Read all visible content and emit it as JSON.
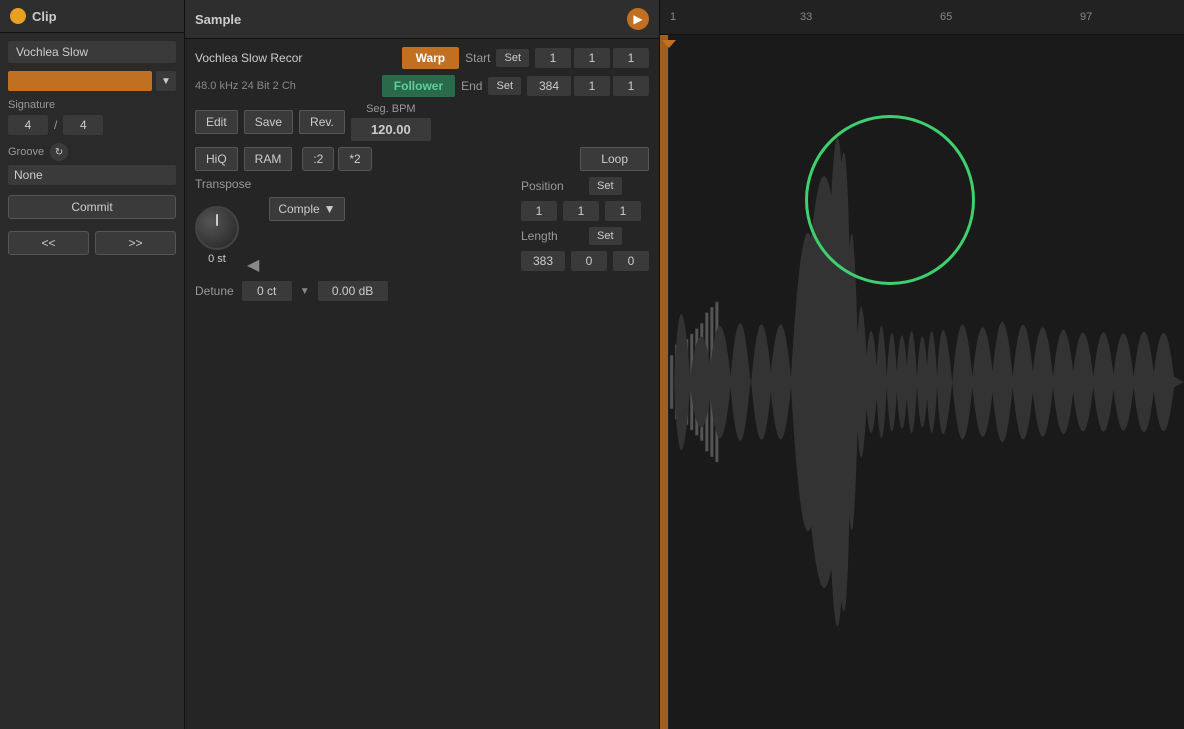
{
  "clip_panel": {
    "title": "Clip",
    "clip_name": "Vochlea Slow",
    "color": "#c07020",
    "signature_label": "Signature",
    "sig_num": "4",
    "sig_den": "4",
    "groove_label": "Groove",
    "groove_value": "None",
    "commit_label": "Commit",
    "nav_prev": "<<",
    "nav_next": ">>"
  },
  "sample_panel": {
    "title": "Sample",
    "filename": "Vochlea Slow Recor",
    "file_info": "48.0 kHz 24 Bit 2 Ch",
    "warp_label": "Warp",
    "follower_label": "Follower",
    "edit_label": "Edit",
    "save_label": "Save",
    "rev_label": "Rev.",
    "hiq_label": "HiQ",
    "ram_label": "RAM",
    "seg_bpm_label": "Seg. BPM",
    "bpm_value": "120.00",
    "half_label": ":2",
    "double_label": "*2",
    "start_label": "Start",
    "set_label": "Set",
    "start_num1": "1",
    "start_num2": "1",
    "start_num3": "1",
    "end_label": "End",
    "end_set_label": "Set",
    "end_num1": "384",
    "end_num2": "1",
    "end_num3": "1",
    "transpose_label": "Transpose",
    "transpose_value": "0 st",
    "loop_label": "Loop",
    "complex_label": "Comple",
    "position_label": "Position",
    "pos_set_label": "Set",
    "pos_num1": "1",
    "pos_num2": "1",
    "pos_num3": "1",
    "length_label": "Length",
    "len_set_label": "Set",
    "len_num1": "383",
    "len_num2": "0",
    "len_num3": "0",
    "detune_label": "Detune",
    "detune_value": "0 ct",
    "db_value": "0.00 dB"
  },
  "waveform_panel": {
    "ruler_markers": [
      {
        "label": "1",
        "pos_pct": 0
      },
      {
        "label": "33",
        "pos_pct": 25
      },
      {
        "label": "65",
        "pos_pct": 55
      },
      {
        "label": "97",
        "pos_pct": 80
      }
    ]
  }
}
